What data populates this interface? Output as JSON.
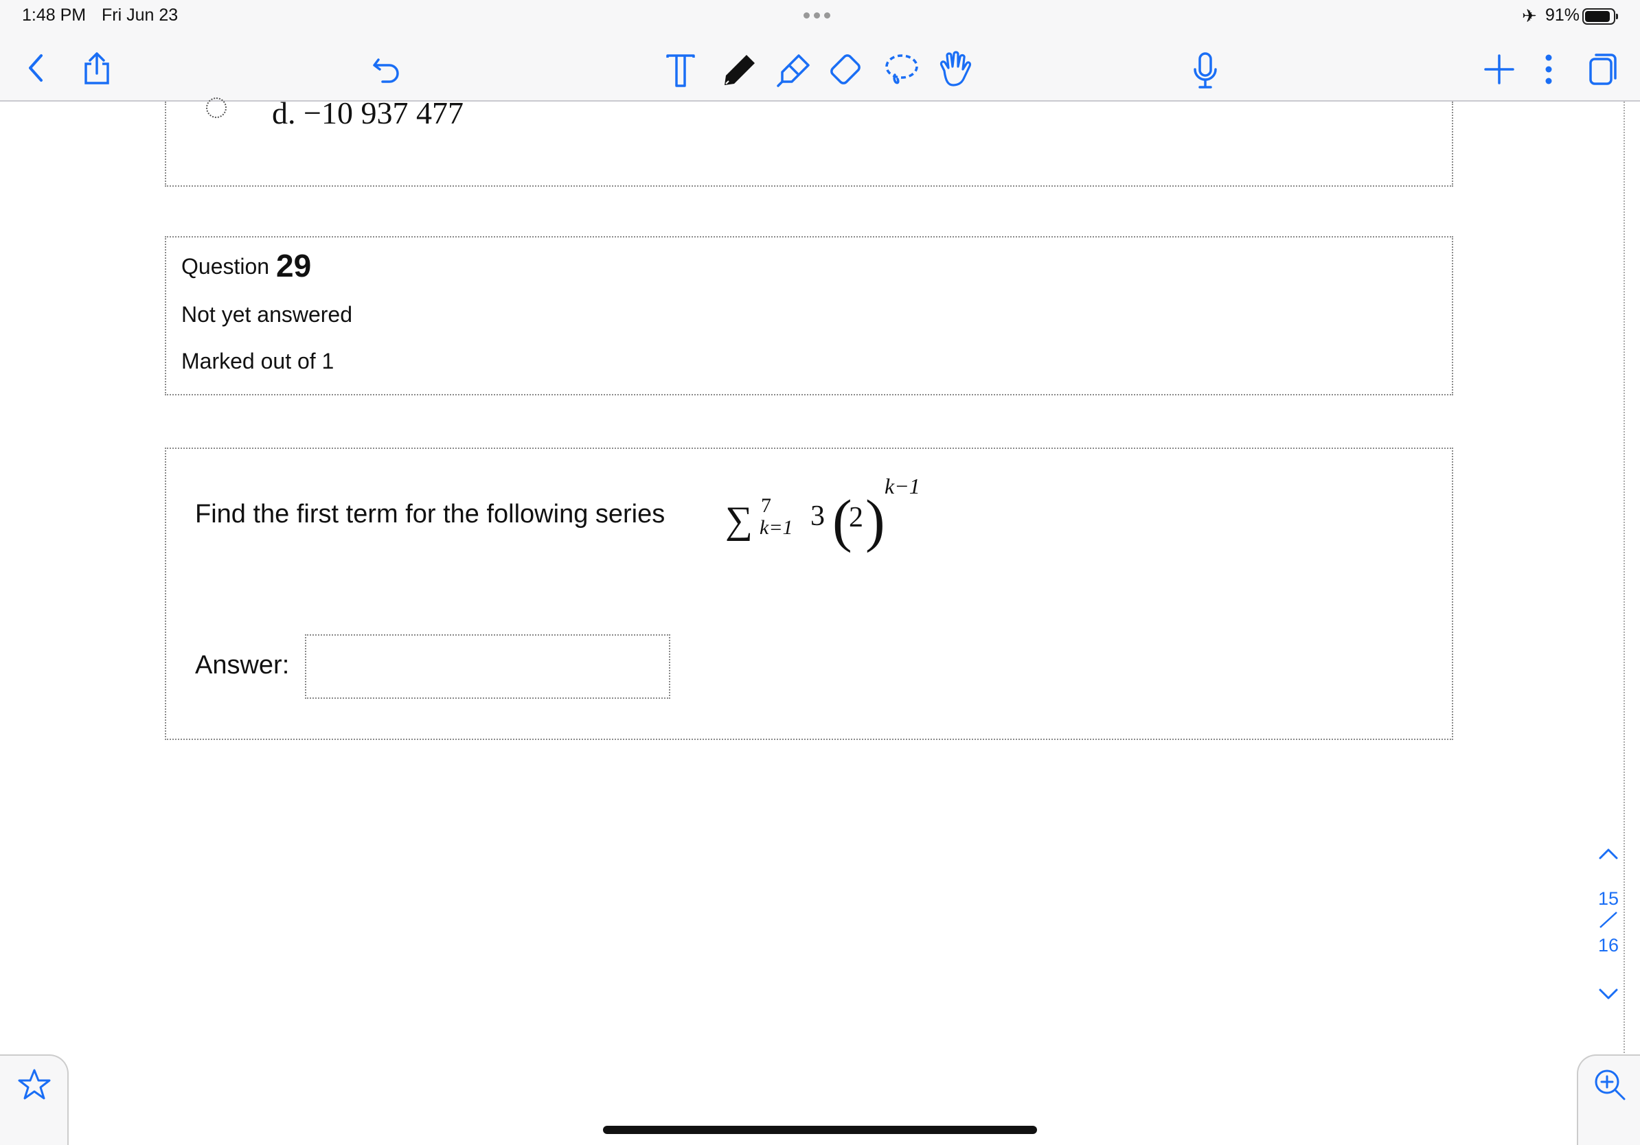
{
  "status_bar": {
    "time": "1:48 PM",
    "date": "Fri Jun 23",
    "battery": "91%"
  },
  "toolbar": {
    "icons": [
      "back-chevron-icon",
      "share-icon",
      "undo-icon",
      "text-tool-icon",
      "pen-icon",
      "highlighter-icon",
      "eraser-icon",
      "lasso-icon",
      "hand-pointer-icon",
      "microphone-icon",
      "add-icon",
      "more-vertical-icon",
      "pages-icon"
    ],
    "accent": "#1a6ef5"
  },
  "previous_question": {
    "option_label": "d. −10 937 477"
  },
  "question": {
    "label": "Question",
    "number": "29",
    "status": "Not yet answered",
    "marks": "Marked out of 1",
    "prompt": "Find the first term for the following series",
    "math": {
      "sigma": "∑",
      "upper": "7",
      "lower": "k=1",
      "coefficient": "3",
      "base": "2",
      "exponent": "k−1"
    },
    "answer_label": "Answer:",
    "answer_value": ""
  },
  "pager": {
    "current": "15",
    "total": "16"
  }
}
